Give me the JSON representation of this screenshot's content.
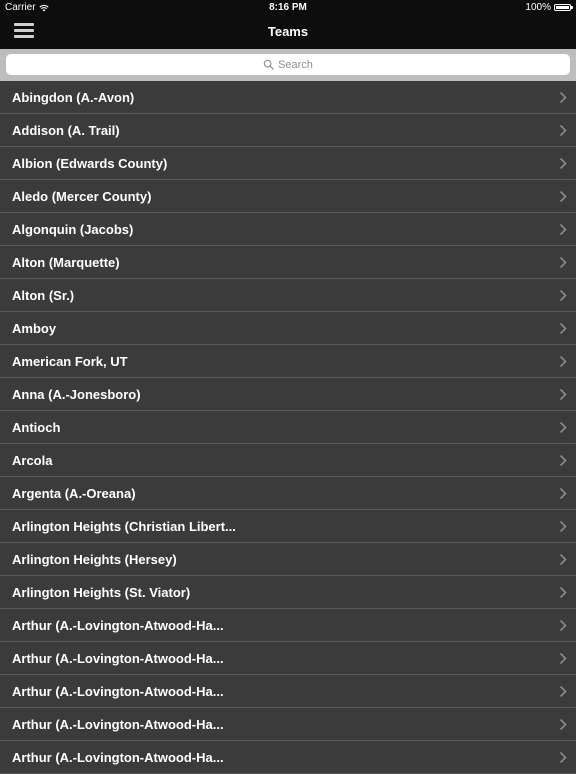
{
  "status_bar": {
    "carrier": "Carrier",
    "time": "8:16 PM",
    "battery": "100%"
  },
  "nav": {
    "title": "Teams"
  },
  "search": {
    "placeholder": "Search"
  },
  "teams": [
    "Abingdon (A.-Avon)",
    "Addison (A. Trail)",
    "Albion (Edwards County)",
    "Aledo (Mercer County)",
    "Algonquin (Jacobs)",
    "Alton (Marquette)",
    "Alton (Sr.)",
    "Amboy",
    "American Fork, UT",
    "Anna (A.-Jonesboro)",
    "Antioch",
    "Arcola",
    "Argenta (A.-Oreana)",
    "Arlington Heights (Christian Libert...",
    "Arlington Heights (Hersey)",
    "Arlington Heights (St. Viator)",
    "Arthur (A.-Lovington-Atwood-Ha...",
    "Arthur (A.-Lovington-Atwood-Ha...",
    "Arthur (A.-Lovington-Atwood-Ha...",
    "Arthur (A.-Lovington-Atwood-Ha...",
    "Arthur (A.-Lovington-Atwood-Ha..."
  ]
}
